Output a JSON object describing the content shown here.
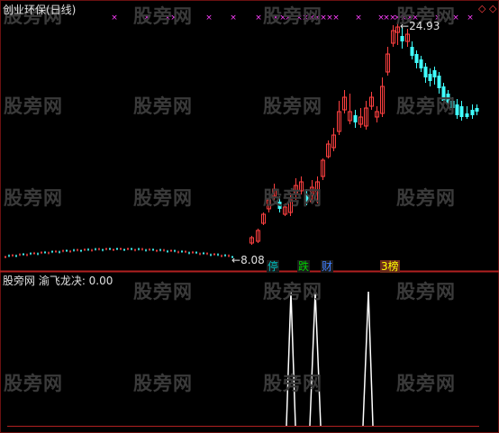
{
  "main_panel": {
    "title": "创业环保(日线)",
    "high_label": "24.93",
    "low_label": "8.08",
    "diamonds": "◇ ◇",
    "badges": [
      {
        "text": "停",
        "color": "#00c0c0",
        "bg": "#1a1a1a"
      },
      {
        "text": "跌",
        "color": "#00d000",
        "bg": "#1a1a1a"
      },
      {
        "text": "财",
        "color": "#4080ff",
        "bg": "#1a1a1a"
      },
      {
        "text": "3榜",
        "color": "#ffff00",
        "bg": "#6b2a1a"
      }
    ]
  },
  "indicator_panel": {
    "title": "股旁网 渝飞龙决: 0.00"
  },
  "watermark": "股旁网",
  "colors": {
    "up_candle": "#ff4040",
    "down_candle": "#40ffff",
    "marker": "#ff40ff",
    "separator": "#b02020",
    "indicator_line": "#ffffff"
  }
}
